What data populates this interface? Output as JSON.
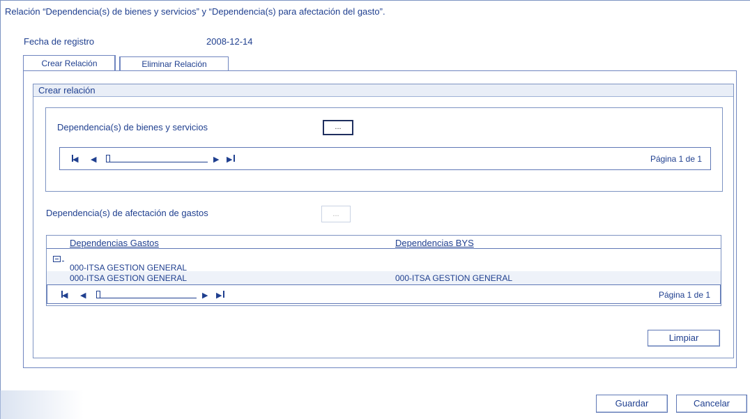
{
  "window": {
    "title": "Relación “Dependencia(s) de bienes y servicios” y “Dependencia(s) para afectación del gasto”."
  },
  "registro": {
    "label": "Fecha de registro",
    "value": "2008-12-14"
  },
  "tabs": [
    {
      "label": "Crear Relación",
      "active": true
    },
    {
      "label": "Eliminar Relación",
      "active": false
    }
  ],
  "section": {
    "title": "Crear relación"
  },
  "bienes": {
    "label": "Dependencia(s) de bienes y servicios",
    "button_label": "...",
    "pager_text": "Página 1 de 1"
  },
  "gastos": {
    "label": "Dependencia(s) de afectación de gastos",
    "button_label": "..."
  },
  "table": {
    "columns": [
      "Dependencias Gastos",
      "Dependencias BYS"
    ],
    "group_label": "000-ITSA GESTION GENERAL",
    "rows": [
      [
        "000-ITSA GESTION GENERAL",
        "000-ITSA GESTION GENERAL"
      ]
    ],
    "pager_text": "Página 1 de 1"
  },
  "buttons": {
    "limpiar": "Limpiar",
    "guardar": "Guardar",
    "cancelar": "Cancelar"
  },
  "icons": {
    "first": "first-page-icon",
    "prev": "prev-page-icon",
    "next": "next-page-icon",
    "last": "last-page-icon",
    "collapse": "collapse-group-icon"
  },
  "colors": {
    "text": "#1f3f8f",
    "border": "#6f85bf",
    "header_bg": "#e9eef7"
  }
}
